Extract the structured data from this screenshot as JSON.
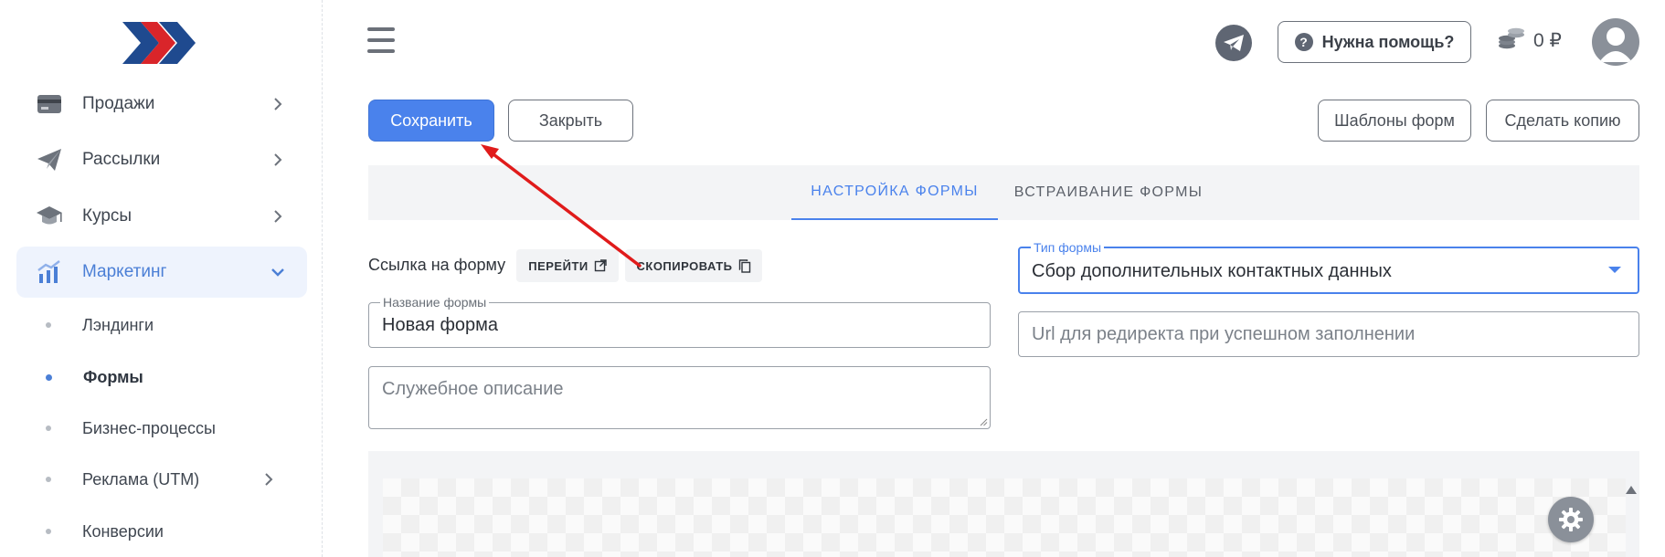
{
  "sidebar": {
    "items": [
      {
        "label": "Продажи",
        "icon": "card-icon"
      },
      {
        "label": "Рассылки",
        "icon": "paper-plane-icon"
      },
      {
        "label": "Курсы",
        "icon": "graduation-cap-icon"
      },
      {
        "label": "Маркетинг",
        "icon": "chart-icon"
      }
    ],
    "subitems": [
      {
        "label": "Лэндинги"
      },
      {
        "label": "Формы"
      },
      {
        "label": "Бизнес-процессы"
      },
      {
        "label": "Реклама (UTM)"
      },
      {
        "label": "Конверсии"
      }
    ]
  },
  "header": {
    "help_label": "Нужна помощь?",
    "help_q": "?",
    "balance": "0 ₽"
  },
  "toolbar": {
    "save_label": "Сохранить",
    "close_label": "Закрыть",
    "templates_label": "Шаблоны форм",
    "copy_label": "Сделать копию"
  },
  "tabs": [
    {
      "label": "НАСТРОЙКА ФОРМЫ"
    },
    {
      "label": "ВСТРАИВАНИЕ ФОРМЫ"
    }
  ],
  "form": {
    "link_label": "Ссылка на форму",
    "go_label": "ПЕРЕЙТИ",
    "copy_link_label": "СКОПИРОВАТЬ",
    "name_legend": "Название формы",
    "name_value": "Новая форма",
    "description_placeholder": "Служебное описание",
    "type_legend": "Тип формы",
    "type_value": "Сбор дополнительных контактных данных",
    "redirect_placeholder": "Url для редиректа при успешном заполнении"
  },
  "colors": {
    "accent": "#4a82ec",
    "annotation_arrow": "#e01b1b"
  }
}
